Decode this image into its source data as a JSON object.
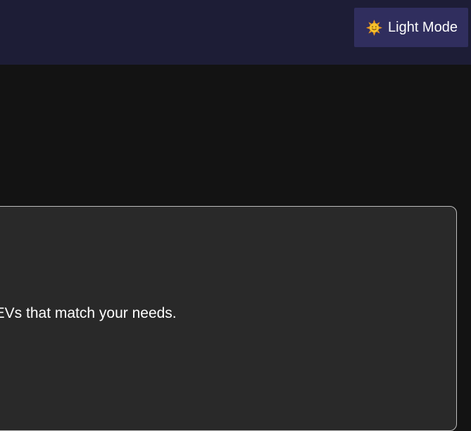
{
  "header": {
    "theme_toggle": {
      "label": "Light Mode",
      "icon": "sun-icon"
    }
  },
  "main": {
    "card": {
      "visible_text": "f EVs that match your needs."
    }
  },
  "colors": {
    "header_bg": "#1d1d36",
    "toggle_bg": "#302e5e",
    "page_bg": "#131313",
    "card_bg": "#292929",
    "card_border": "#bdbdbd",
    "sun_yellow": "#f7c12a",
    "sun_orange": "#f39a1b"
  }
}
